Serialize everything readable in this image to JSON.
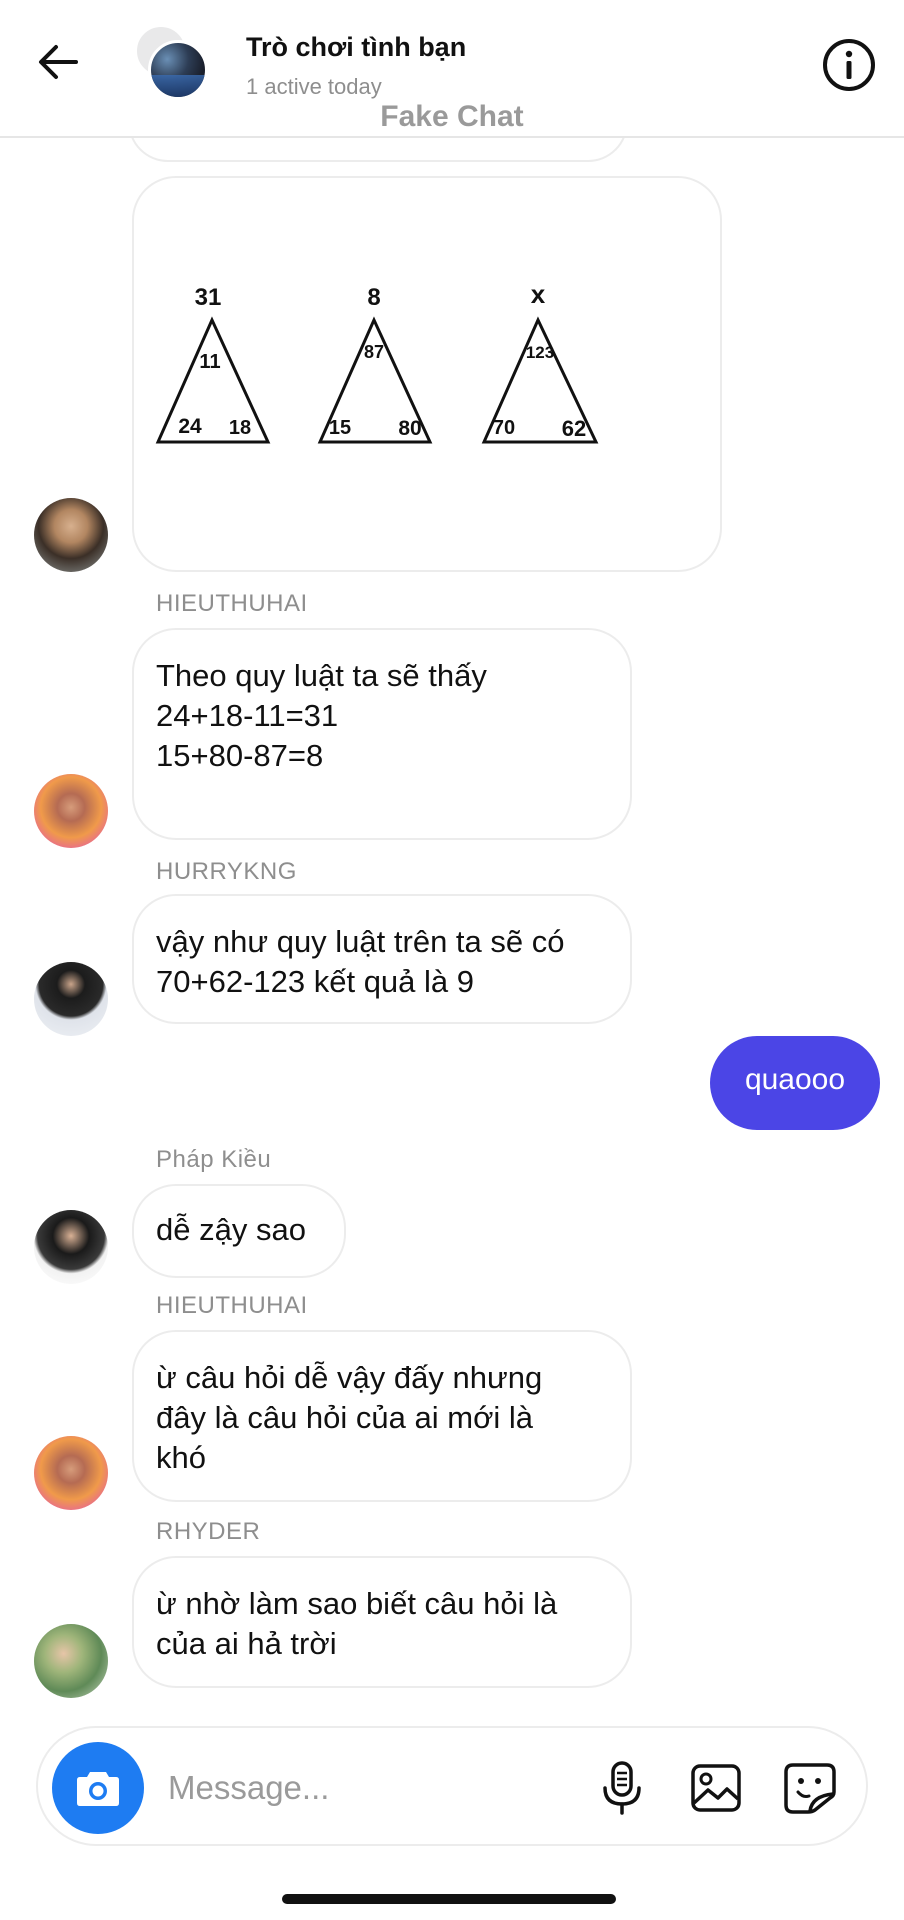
{
  "header": {
    "title": "Trò chơi tình bạn",
    "status": "1 active today",
    "watermark": "Fake Chat"
  },
  "puzzle": {
    "triangles": [
      {
        "top": "31",
        "inner": "11",
        "left": "24",
        "right": "18"
      },
      {
        "top": "8",
        "inner": "87",
        "left": "15",
        "right": "80"
      },
      {
        "top": "x",
        "inner": "123",
        "left": "70",
        "right": "62"
      }
    ]
  },
  "messages": [
    {
      "sender": "HIEUTHUHAI",
      "lines": [
        "Theo quy luật ta sẽ thấy",
        "24+18-11=31",
        "15+80-87=8"
      ]
    },
    {
      "sender": "HURRYKNG",
      "lines": [
        "vậy như quy luật trên ta sẽ có",
        "70+62-123 kết quả là 9"
      ]
    },
    {
      "outgoing": "quaooo"
    },
    {
      "sender": "Pháp Kiều",
      "lines": [
        "dễ zậy sao"
      ]
    },
    {
      "sender": "HIEUTHUHAI",
      "lines": [
        "ừ câu hỏi dễ vậy đấy nhưng",
        "đây là câu hỏi của ai mới là",
        "khó"
      ]
    },
    {
      "sender": "RHYDER",
      "lines": [
        "ừ nhờ làm sao biết câu hỏi là",
        "của ai hả trời"
      ]
    }
  ],
  "composer": {
    "placeholder": "Message..."
  },
  "icons": {
    "back": "arrow-left-icon",
    "info": "info-circle-icon",
    "camera": "camera-icon",
    "mic": "microphone-icon",
    "gallery": "image-icon",
    "sticker": "sticker-icon"
  },
  "colors": {
    "outgoing_bubble": "#4b45e6",
    "camera_button": "#1e7cf2"
  }
}
